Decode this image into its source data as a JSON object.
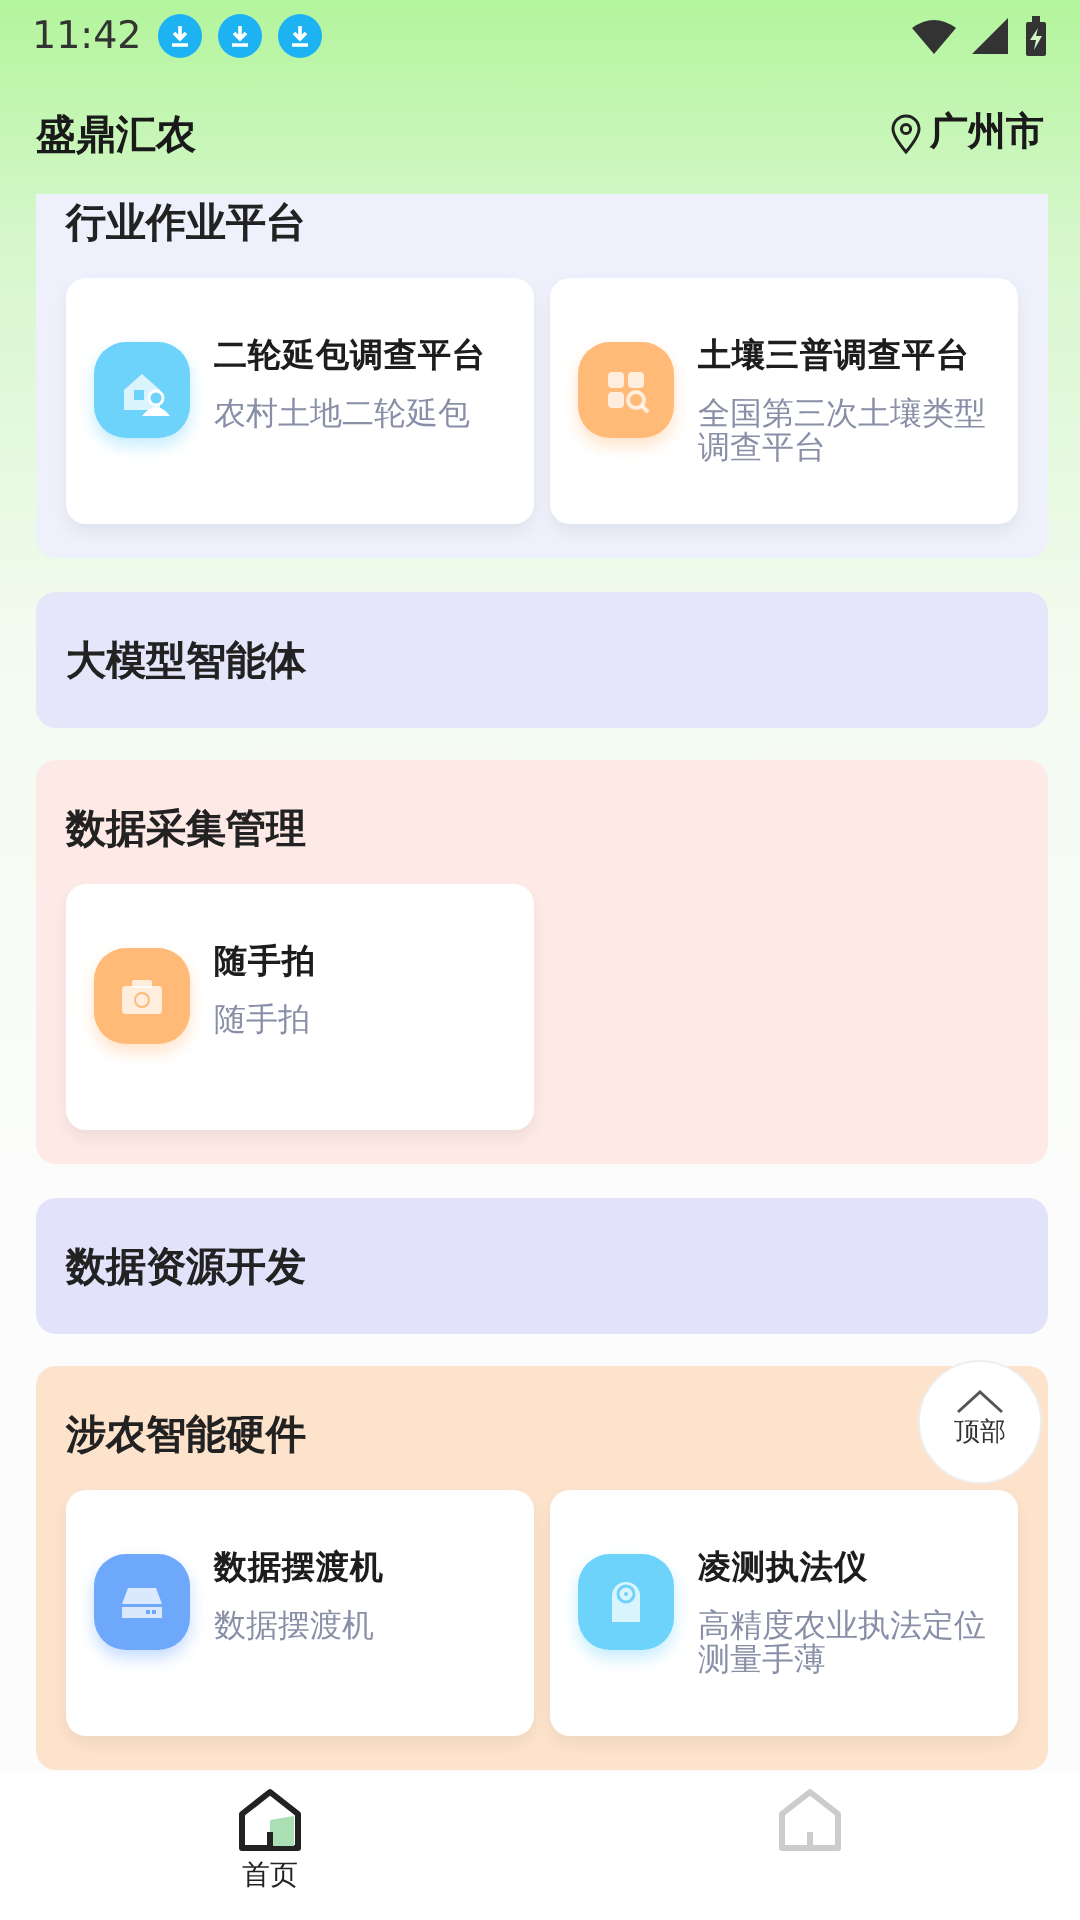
{
  "status_bar": {
    "time": "11:42",
    "notifications": [
      {
        "kind": "download"
      },
      {
        "kind": "download"
      },
      {
        "kind": "download"
      }
    ]
  },
  "header": {
    "title": "盛鼎汇农",
    "location": "广州市"
  },
  "sections": [
    {
      "title": "行业作业平台",
      "color": "#eef0fc",
      "cards": [
        {
          "title": "二轮延包调查平台",
          "subtitle": "农村土地二轮延包",
          "color": "#6dd3fb"
        },
        {
          "title": "土壤三普调查平台",
          "subtitle": "全国第三次土壤类型调查平台",
          "color": "#ffba77"
        }
      ]
    },
    {
      "title": "大模型智能体",
      "color": "#e6e6fa"
    },
    {
      "title": "数据采集管理",
      "color": "#fde9e5",
      "cards": [
        {
          "title": "随手拍",
          "subtitle": "随手拍",
          "color": "#ffba77"
        }
      ]
    },
    {
      "title": "数据资源开发",
      "color": "#e2e2fa"
    },
    {
      "title": "涉农智能硬件",
      "color": "#fde3cc",
      "cards": [
        {
          "title": "数据摆渡机",
          "subtitle": "数据摆渡机",
          "color": "#6ea8fb"
        },
        {
          "title": "凌测执法仪",
          "subtitle": "高精度农业执法定位测量手薄",
          "color": "#6dd3fb"
        }
      ]
    }
  ],
  "back_to_top": {
    "label": "顶部"
  },
  "nav": [
    {
      "label": "首页",
      "selected": true
    },
    {
      "selected": false
    }
  ]
}
